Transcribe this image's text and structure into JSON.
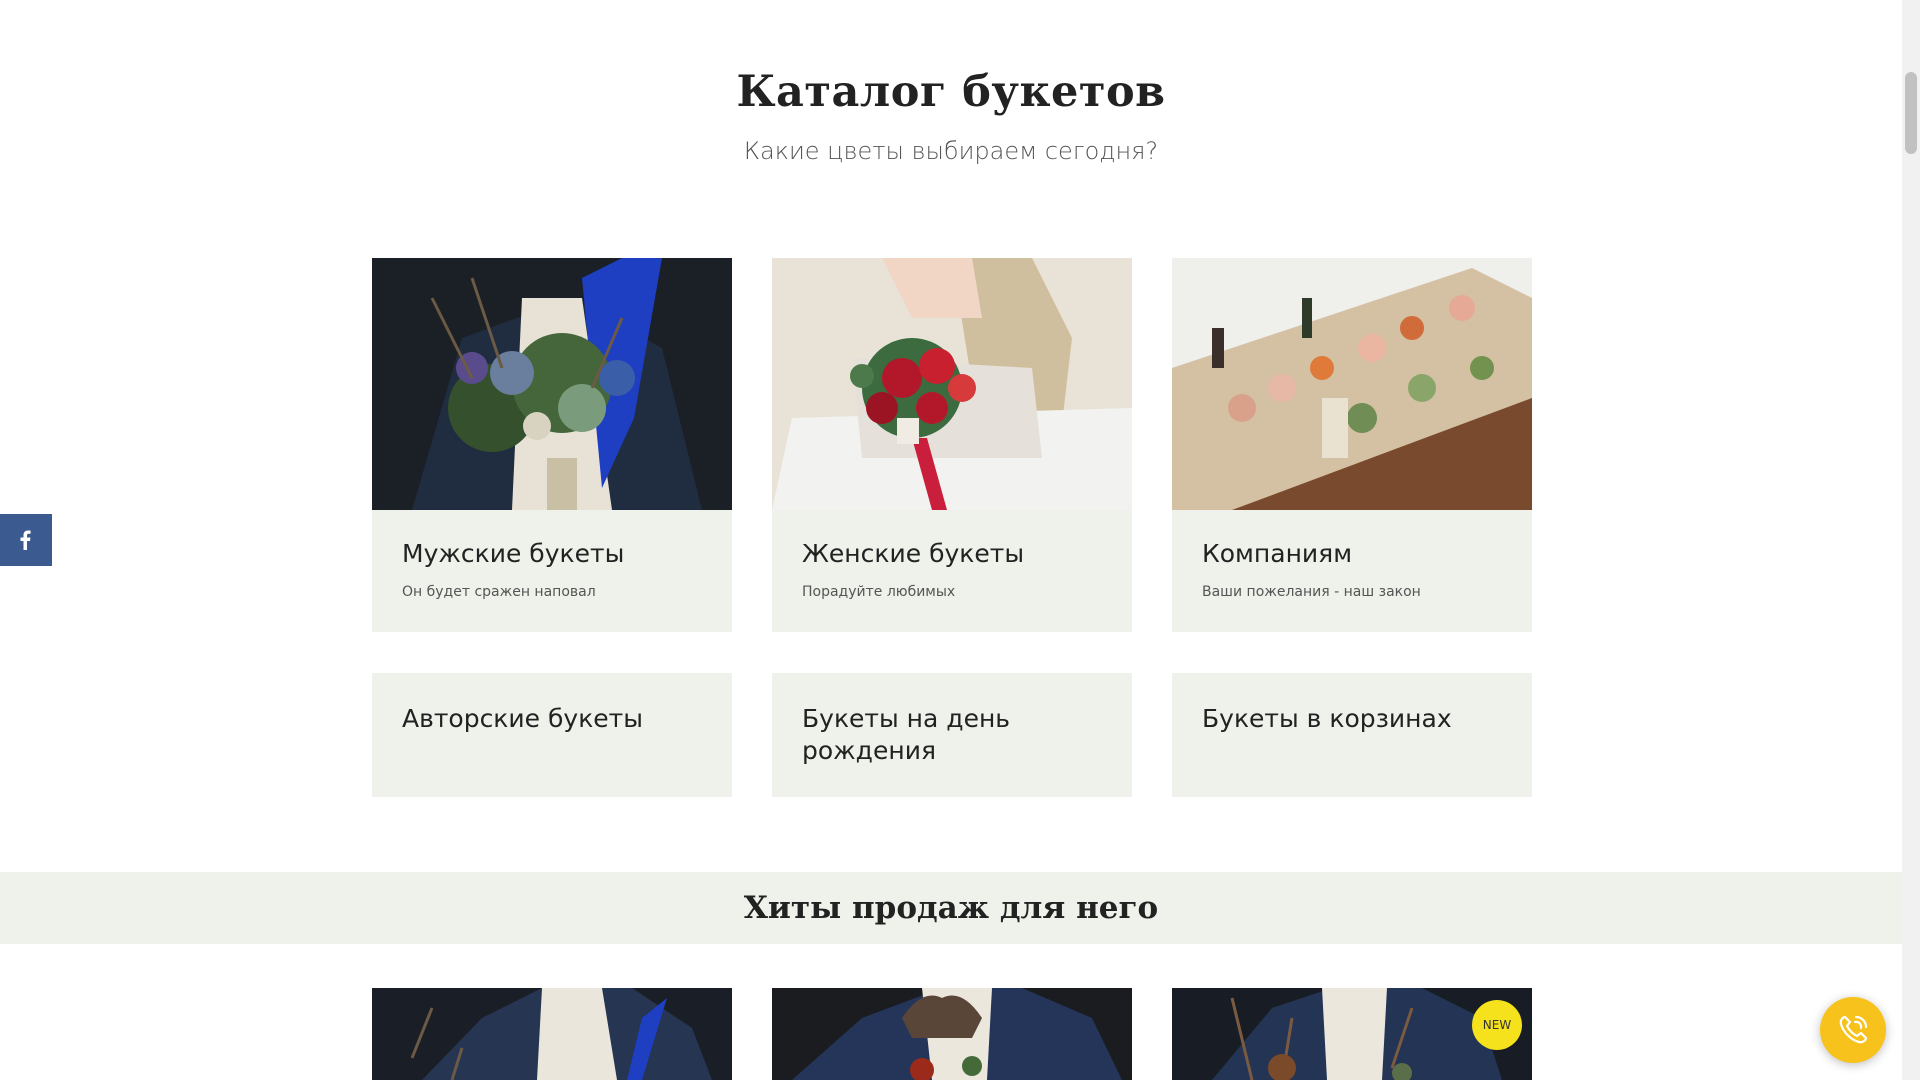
{
  "catalog": {
    "title": "Каталог букетов",
    "subtitle": "Какие цветы выбираем сегодня?"
  },
  "categories": [
    {
      "title": "Мужские букеты",
      "desc": "Он будет сражен наповал"
    },
    {
      "title": "Женские букеты",
      "desc": "Порадуйте любимых"
    },
    {
      "title": "Компаниям",
      "desc": "Ваши пожелания - наш закон"
    },
    {
      "title": "Авторские букеты"
    },
    {
      "title": "Букеты на день рождения"
    },
    {
      "title": "Букеты в корзинах"
    }
  ],
  "hits": {
    "title": "Хиты продаж для него",
    "badge": "NEW"
  },
  "icons": {
    "social": "facebook-icon",
    "call": "phone-icon"
  },
  "colors": {
    "card_bg": "#eef2ea",
    "facebook": "#3b5a8f",
    "call_button": "#f7c21b",
    "badge": "#f5e21d"
  }
}
